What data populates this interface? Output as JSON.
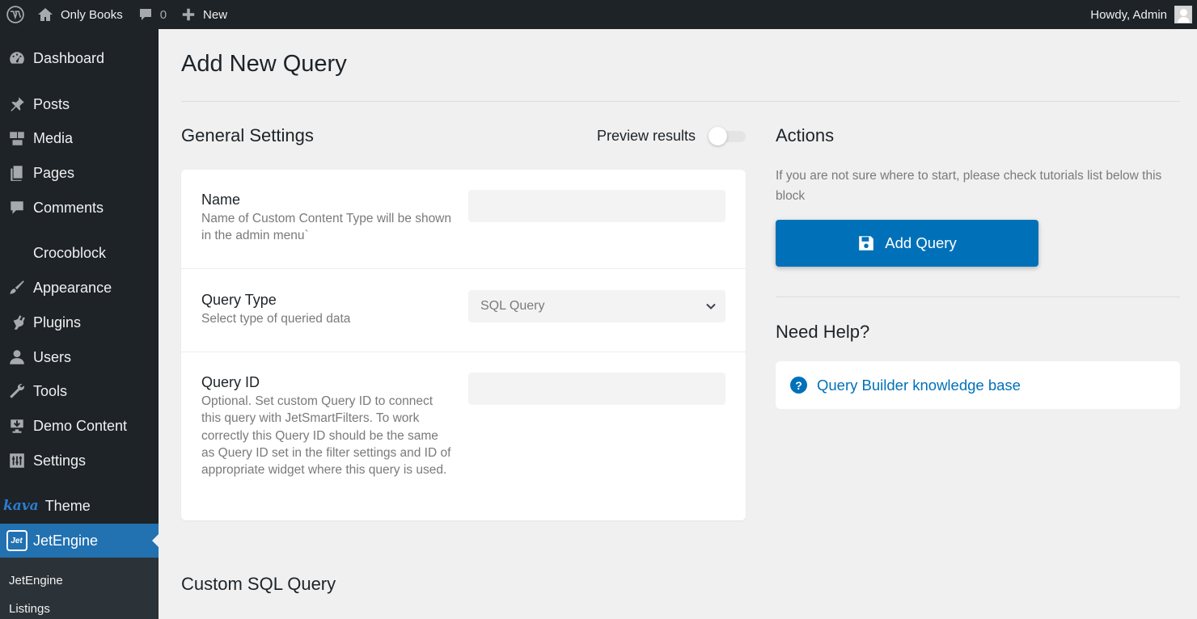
{
  "adminbar": {
    "site_name": "Only Books",
    "comments_count": "0",
    "new_label": "New",
    "howdy": "Howdy, Admin"
  },
  "sidebar": {
    "items": [
      {
        "label": "Dashboard",
        "icon": "dashboard-icon"
      },
      {
        "label": "Posts",
        "icon": "pushpin-icon"
      },
      {
        "label": "Media",
        "icon": "media-icon"
      },
      {
        "label": "Pages",
        "icon": "pages-icon"
      },
      {
        "label": "Comments",
        "icon": "comment-icon"
      },
      {
        "label": "Crocoblock",
        "icon": "crocoblock-icon"
      },
      {
        "label": "Appearance",
        "icon": "paintbrush-icon"
      },
      {
        "label": "Plugins",
        "icon": "plugin-icon"
      },
      {
        "label": "Users",
        "icon": "user-icon"
      },
      {
        "label": "Tools",
        "icon": "wrench-icon"
      },
      {
        "label": "Demo Content",
        "icon": "download-icon"
      },
      {
        "label": "Settings",
        "icon": "settings-icon"
      },
      {
        "label": "Theme",
        "icon": "kava-logo",
        "brand": "kava"
      },
      {
        "label": "JetEngine",
        "icon": "jetengine-icon",
        "badge": "Jet"
      }
    ],
    "submenu": [
      "JetEngine",
      "Listings"
    ]
  },
  "page": {
    "title": "Add New Query",
    "general_settings_title": "General Settings",
    "preview_label": "Preview results",
    "preview_enabled": false,
    "fields": [
      {
        "label": "Name",
        "description": "Name of Custom Content Type will be shown in the admin menu`",
        "value": "",
        "placeholder": ""
      },
      {
        "label": "Query Type",
        "description": "Select type of queried data",
        "selected": "SQL Query"
      },
      {
        "label": "Query ID",
        "description": "Optional. Set custom Query ID to connect this query with JetSmartFilters. To work correctly this Query ID should be the same as Query ID set in the filter settings and ID of appropriate widget where this query is used.",
        "value": "",
        "placeholder": ""
      }
    ],
    "custom_sql_title": "Custom SQL Query"
  },
  "actions": {
    "title": "Actions",
    "hint": "If you are not sure where to start, please check tutorials list below this block",
    "add_button": "Add Query"
  },
  "help": {
    "title": "Need Help?",
    "link": "Query Builder knowledge base"
  },
  "colors": {
    "admin_dark": "#1d2327",
    "accent_blue": "#2271b1",
    "button_blue": "#0071b9",
    "background": "#f0f0f1"
  }
}
